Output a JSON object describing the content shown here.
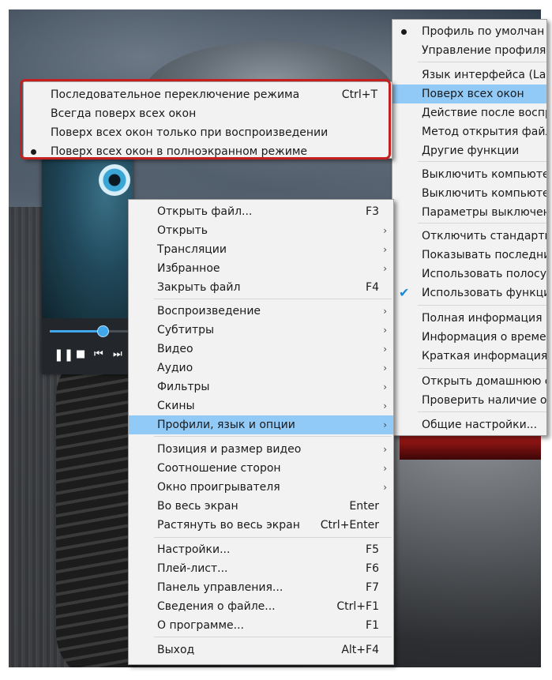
{
  "background": {
    "description_free": true
  },
  "player": {
    "controls": {
      "pause": "❚❚",
      "stop": "■",
      "prev": "⏮",
      "next": "⏭"
    },
    "seek_progress": 0.65,
    "icons": [
      "pause-icon",
      "stop-icon",
      "previous-icon",
      "next-icon"
    ]
  },
  "colors": {
    "highlight": "#91c9f7",
    "accent": "#3fa7ea",
    "callout": "#c51f1f"
  },
  "top_submenu": {
    "items": [
      {
        "label": "Последовательное переключение режима",
        "shortcut": "Ctrl+T"
      },
      {
        "label": "Всегда поверх всех окон",
        "shortcut": ""
      },
      {
        "label": "Поверх всех окон только при воспроизведении",
        "shortcut": ""
      },
      {
        "label": "Поверх всех окон в полноэкранном режиме",
        "shortcut": "",
        "selected": true
      }
    ]
  },
  "right_submenu": {
    "items": [
      {
        "label": "Профиль по умолчан",
        "selected": true
      },
      {
        "label": "Управление профиля"
      },
      {
        "label": "Язык интерфейса (Lan"
      },
      {
        "label": "Поверх всех окон",
        "highlighted": true
      },
      {
        "label": "Действие после воспр"
      },
      {
        "label": "Метод открытия файл"
      },
      {
        "label": "Другие функции"
      },
      {
        "label": "Выключить компьюте"
      },
      {
        "label": "Выключить компьюте"
      },
      {
        "label": "Параметры выключен"
      },
      {
        "label": "Отключить стандартн"
      },
      {
        "label": "Показывать последни"
      },
      {
        "label": "Использовать полосу"
      },
      {
        "label": "Использовать функци",
        "checked": true
      },
      {
        "label": "Полная информация"
      },
      {
        "label": "Информация о време"
      },
      {
        "label": "Краткая информация"
      },
      {
        "label": "Открыть домашнюю с"
      },
      {
        "label": "Проверить наличие о"
      },
      {
        "label": "Общие настройки..."
      }
    ]
  },
  "main_menu": {
    "items": [
      {
        "label": "Открыть файл...",
        "shortcut": "F3"
      },
      {
        "label": "Открыть",
        "submenu": true
      },
      {
        "label": "Трансляции",
        "submenu": true
      },
      {
        "label": "Избранное",
        "submenu": true
      },
      {
        "label": "Закрыть файл",
        "shortcut": "F4"
      },
      {
        "label": "Воспроизведение",
        "submenu": true
      },
      {
        "label": "Субтитры",
        "submenu": true
      },
      {
        "label": "Видео",
        "submenu": true
      },
      {
        "label": "Аудио",
        "submenu": true
      },
      {
        "label": "Фильтры",
        "submenu": true
      },
      {
        "label": "Скины",
        "submenu": true
      },
      {
        "label": "Профили, язык и опции",
        "submenu": true,
        "highlighted": true
      },
      {
        "label": "Позиция и размер видео",
        "submenu": true
      },
      {
        "label": "Соотношение сторон",
        "submenu": true
      },
      {
        "label": "Окно проигрывателя",
        "submenu": true
      },
      {
        "label": "Во весь экран",
        "shortcut": "Enter"
      },
      {
        "label": "Растянуть во весь экран",
        "shortcut": "Ctrl+Enter"
      },
      {
        "label": "Настройки...",
        "shortcut": "F5"
      },
      {
        "label": "Плей-лист...",
        "shortcut": "F6"
      },
      {
        "label": "Панель управления...",
        "shortcut": "F7"
      },
      {
        "label": "Сведения о файле...",
        "shortcut": "Ctrl+F1"
      },
      {
        "label": "О программе...",
        "shortcut": "F1"
      },
      {
        "label": "Выход",
        "shortcut": "Alt+F4"
      }
    ],
    "submenu_arrow": "›"
  }
}
